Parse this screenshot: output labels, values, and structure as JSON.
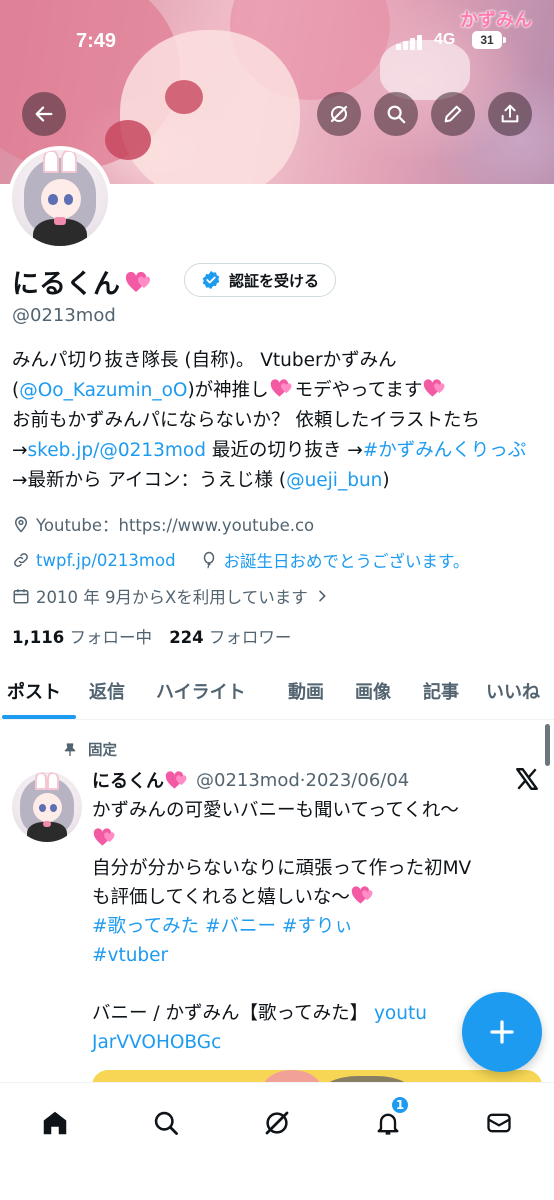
{
  "status_bar": {
    "time": "7:49",
    "network": "4G",
    "battery": "31"
  },
  "banner": {
    "logo_text": "かずみん"
  },
  "profile": {
    "name": "にるくん",
    "verify_label": "認証を受ける",
    "handle": "@0213mod",
    "bio": {
      "p1": "みんパ切り抜き隊長 (自称)。 Vtuberかずみん",
      "p2_pre": "(",
      "p2_link": "@Oo_Kazumin_oO",
      "p2_post": ")が神推し",
      "p3": "モデやってます",
      "p4": "お前もかずみんパにならないか？ 依頼したイラストたち →",
      "p4_link": "skeb.jp/@0213mod",
      "p5": " 最近の切り抜き →",
      "p5_link": "#かずみんくりっぷ",
      "p6": " →最新から アイコン：うえじ様 (",
      "p6_link": "@ueji_bun",
      "p6_post": ")"
    },
    "location": "Youtube：https://www.youtube.co",
    "website": "twpf.jp/0213mod",
    "birthday": "お誕生日おめでとうございます。",
    "joined": "2010 年 9月からXを利用しています",
    "following_count": "1,116",
    "following_label": "フォロー中",
    "followers_count": "224",
    "followers_label": "フォロワー"
  },
  "tabs": [
    "ポスト",
    "返信",
    "ハイライト",
    "動画",
    "画像",
    "記事",
    "いいね"
  ],
  "tweet": {
    "pinned_label": "固定",
    "name": "にるくん",
    "handle_date": "@0213mod·2023/06/04",
    "line1": "かずみんの可愛いバニーも聞いてってくれ〜",
    "line2": "自分が分からないなりに頑張って作った初MV",
    "line3": "も評価してくれると嬉しいな〜",
    "hashtags1": "#歌ってみた #バニー #すりぃ",
    "hashtags2": "#vtuber",
    "line4": "バニー / かずみん【歌ってみた】 ",
    "link1": "youtu",
    "link2": "JarVVOHOBGc"
  },
  "nav": {
    "notifications_badge": "1"
  },
  "colors": {
    "accent": "#1d9bf0",
    "text": "#0f1419",
    "muted": "#536471"
  }
}
